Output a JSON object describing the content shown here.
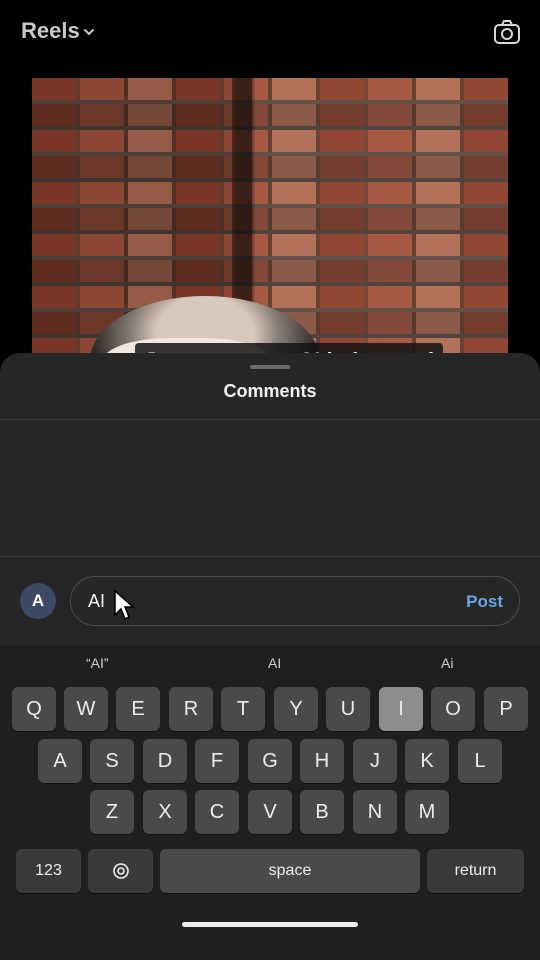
{
  "header": {
    "title": "Reels",
    "chevron_icon": "chevron-down-icon",
    "camera_icon": "camera-icon"
  },
  "video": {
    "caption": "Just comment AI below and"
  },
  "comments_sheet": {
    "title": "Comments",
    "avatar_letter": "A",
    "input_value": "AI",
    "post_label": "Post"
  },
  "keyboard": {
    "suggestions": [
      "“AI”",
      "AI",
      "Ai"
    ],
    "row1": [
      "Q",
      "W",
      "E",
      "R",
      "T",
      "Y",
      "U",
      "I",
      "O",
      "P"
    ],
    "row2": [
      "A",
      "S",
      "D",
      "F",
      "G",
      "H",
      "J",
      "K",
      "L"
    ],
    "row3": [
      "Z",
      "X",
      "C",
      "V",
      "B",
      "N",
      "M"
    ],
    "numbers_label": "123",
    "emoji_icon": "emoji-icon",
    "space_label": "space",
    "return_label": "return",
    "highlighted_key": "I"
  }
}
